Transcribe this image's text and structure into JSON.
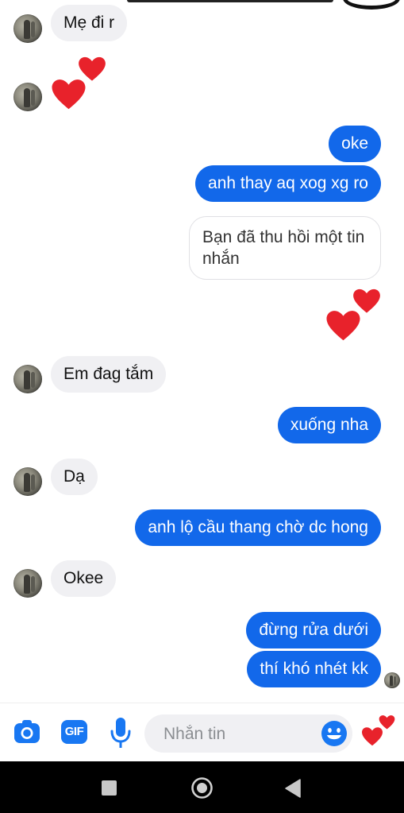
{
  "messages": {
    "m1": "Mẹ đi r",
    "m2": "oke",
    "m3": "anh thay aq xog xg ro",
    "m4": "Bạn đã thu hồi một tin nhắn",
    "m5": "Em đag tắm",
    "m6": "xuống nha",
    "m7": "Dạ",
    "m8": "anh lộ cầu thang chờ dc hong",
    "m9": "Okee",
    "m10": "đừng rửa dưới",
    "m11": "thí khó nhét kk"
  },
  "composer": {
    "placeholder": "Nhắn tin",
    "gif_label": "GIF",
    "icons": [
      "camera-icon",
      "gif-icon",
      "microphone-icon",
      "emoji-icon",
      "heart-reaction-icon"
    ]
  },
  "navbar": {
    "icons": [
      "recent-apps-icon",
      "home-icon",
      "back-icon"
    ]
  },
  "colors": {
    "outgoing_bubble": "#1268ea",
    "incoming_bubble": "#f0f0f3",
    "accent_icon": "#1877f2",
    "heart": "#e8222b"
  }
}
